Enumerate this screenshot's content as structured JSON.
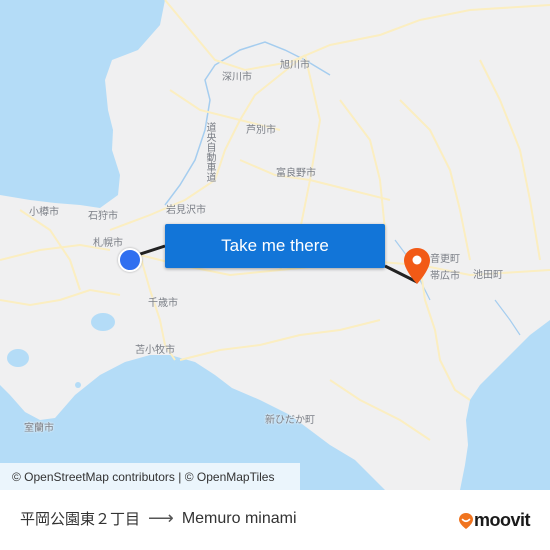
{
  "map": {
    "cities": [
      {
        "id": "asahikawa",
        "label": "旭川市"
      },
      {
        "id": "fukagawa",
        "label": "深川市"
      },
      {
        "id": "ashibetsu",
        "label": "芦別市"
      },
      {
        "id": "furano",
        "label": "富良野市"
      },
      {
        "id": "iwamizawa",
        "label": "岩見沢市"
      },
      {
        "id": "otaru",
        "label": "小樽市"
      },
      {
        "id": "ishikari",
        "label": "石狩市"
      },
      {
        "id": "sapporo",
        "label": "札幌市"
      },
      {
        "id": "chitose",
        "label": "千歳市"
      },
      {
        "id": "tomakomai",
        "label": "苫小牧市"
      },
      {
        "id": "muroran",
        "label": "室蘭市"
      },
      {
        "id": "shinhidaka",
        "label": "新ひだか町"
      },
      {
        "id": "otofuke",
        "label": "音更町"
      },
      {
        "id": "obihiro",
        "label": "帯広市"
      },
      {
        "id": "ikeda",
        "label": "池田町"
      }
    ],
    "highway_label": "道央自動車道",
    "colors": {
      "land": "#f0f0f1",
      "water": "#b4dcf7",
      "road": "#fbeec1",
      "route_line": "#222222",
      "origin_marker": "#2f6ff0",
      "destination_marker": "#f25a16",
      "cta_button": "#1275d8"
    }
  },
  "cta": {
    "label": "Take me there"
  },
  "attribution": {
    "text": "© OpenStreetMap contributors | © OpenMapTiles"
  },
  "footer": {
    "origin": "平岡公園東２丁目",
    "arrow_icon": "arrow-right-icon",
    "destination": "Memuro minami",
    "brand": "moovit"
  }
}
